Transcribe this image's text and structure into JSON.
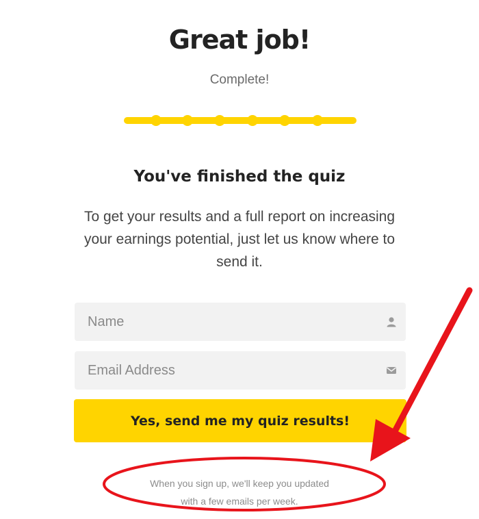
{
  "header": {
    "title": "Great job!",
    "status": "Complete!"
  },
  "progress": {
    "completed_steps": 6,
    "total_steps": 6,
    "color": "#ffd400"
  },
  "content": {
    "heading": "You've finished the quiz",
    "description": "To get your results and a full report on increasing your earnings potential, just let us know where to send it."
  },
  "form": {
    "name": {
      "placeholder": "Name",
      "value": "",
      "icon": "user-icon"
    },
    "email": {
      "placeholder": "Email Address",
      "value": "",
      "icon": "envelope-icon"
    },
    "submit_label": "Yes, send me my quiz results!"
  },
  "footnote": {
    "line1": "When you sign up, we'll keep you updated",
    "line2": "with a few emails per week."
  },
  "annotation": {
    "color": "#e8141b",
    "shapes": [
      "red-arrow",
      "red-ellipse"
    ]
  },
  "colors": {
    "accent": "#ffd400",
    "field_bg": "#f2f2f2",
    "text_dark": "#232323"
  }
}
